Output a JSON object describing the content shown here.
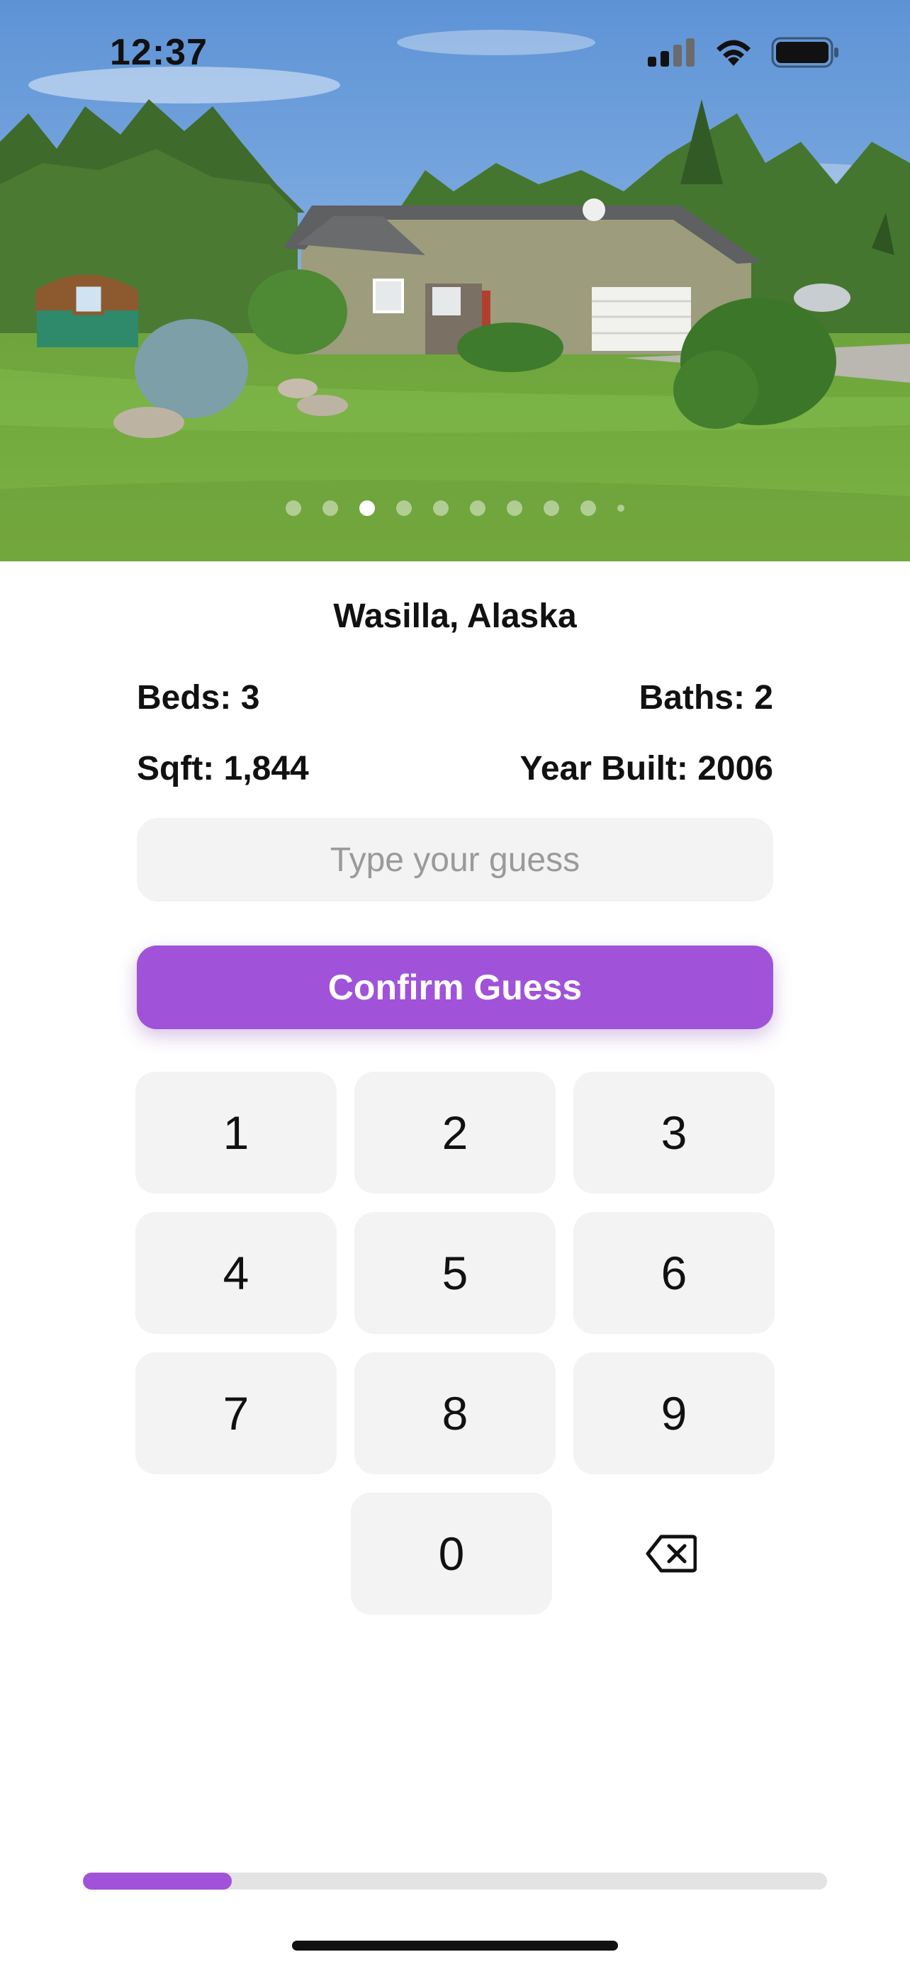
{
  "status_bar": {
    "time": "12:37"
  },
  "gallery": {
    "photo_count": 10,
    "active_index": 2
  },
  "listing": {
    "location": "Wasilla, Alaska",
    "beds": "Beds: 3",
    "baths": "Baths: 2",
    "sqft": "Sqft: 1,844",
    "year_built": "Year Built: 2006"
  },
  "guess": {
    "value": "",
    "placeholder": "Type your guess"
  },
  "confirm": {
    "label": "Confirm Guess"
  },
  "keypad": {
    "k1": "1",
    "k2": "2",
    "k3": "3",
    "k4": "4",
    "k5": "5",
    "k6": "6",
    "k7": "7",
    "k8": "8",
    "k9": "9",
    "k0": "0",
    "backspace_icon": "backspace-icon"
  },
  "progress": {
    "fraction": 0.2
  },
  "colors": {
    "accent": "#a052d8",
    "key_bg": "#f3f3f3"
  }
}
